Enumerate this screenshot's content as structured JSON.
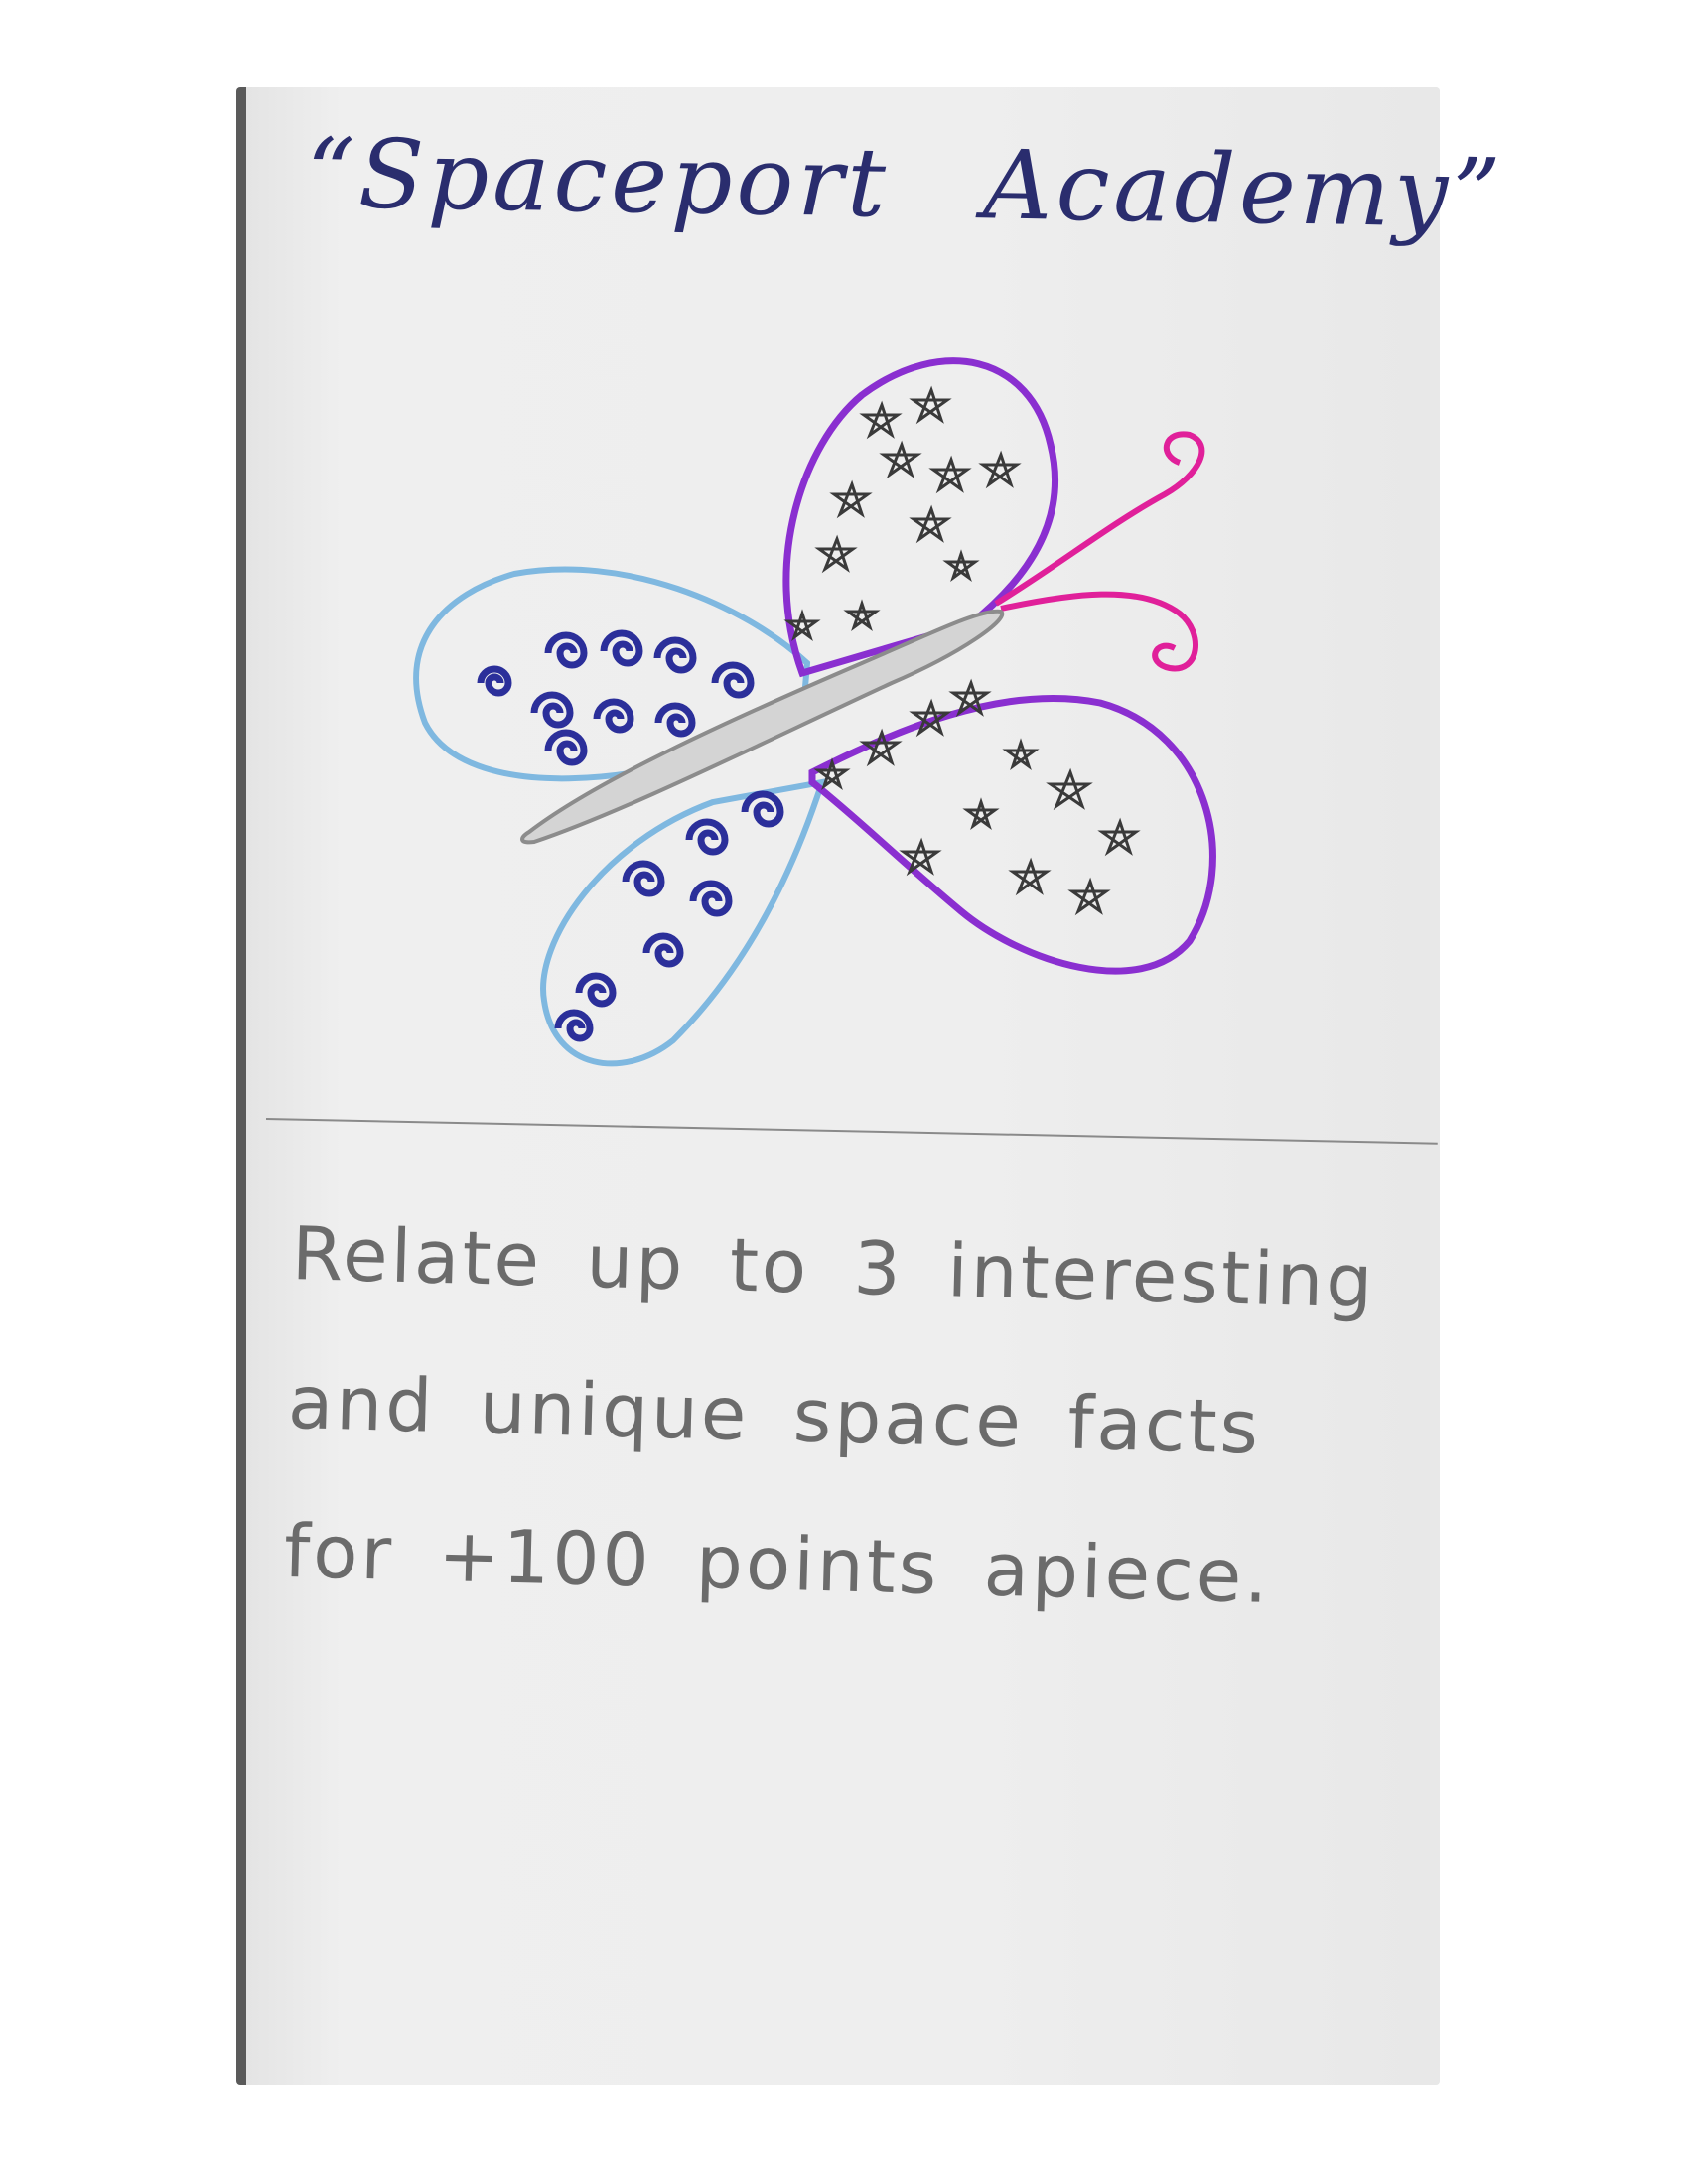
{
  "card": {
    "title": "“Spaceport Academy”",
    "rule_text": "Relate up to 3 interesting and unique space facts for +100 points apiece.",
    "colors": {
      "title_ink": "#2a2d6e",
      "left_wing_outline": "#7fb8e0",
      "swirls": "#2b2f9a",
      "right_wing_outline": "#8a2fd0",
      "antennae": "#e0209a",
      "body": "#d4d4d4",
      "stars": "#3a3a3a",
      "pencil": "#6b6b6b"
    },
    "illustration": {
      "subject": "butterfly",
      "icons": [
        "swirl-icon",
        "star-icon"
      ]
    }
  }
}
